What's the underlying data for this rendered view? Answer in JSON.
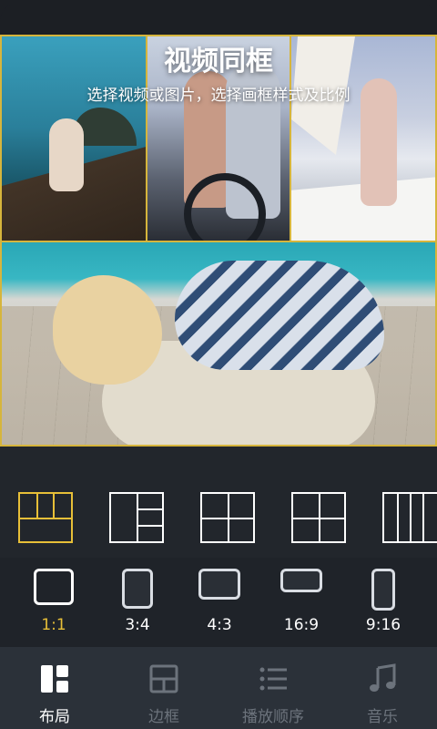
{
  "header": {
    "title": "视频同框",
    "subtitle": "选择视频或图片，选择画框样式及比例"
  },
  "layouts": {
    "items": [
      {
        "name": "layout-1",
        "selected": true
      },
      {
        "name": "layout-2",
        "selected": false
      },
      {
        "name": "layout-3",
        "selected": false
      },
      {
        "name": "layout-4",
        "selected": false
      },
      {
        "name": "layout-5",
        "selected": false
      }
    ]
  },
  "ratios": {
    "items": [
      {
        "label": "1:1",
        "selected": true
      },
      {
        "label": "3:4",
        "selected": false
      },
      {
        "label": "4:3",
        "selected": false
      },
      {
        "label": "16:9",
        "selected": false
      },
      {
        "label": "9:16",
        "selected": false
      }
    ]
  },
  "bottom_nav": {
    "items": [
      {
        "label": "布局",
        "icon": "layout-icon",
        "active": true
      },
      {
        "label": "边框",
        "icon": "border-icon",
        "active": false
      },
      {
        "label": "播放顺序",
        "icon": "list-order-icon",
        "active": false
      },
      {
        "label": "音乐",
        "icon": "music-note-icon",
        "active": false
      }
    ]
  },
  "colors": {
    "accent": "#e7bf38",
    "background": "#22262c",
    "nav_background": "#2b3139",
    "inactive_text": "#6c737c"
  }
}
